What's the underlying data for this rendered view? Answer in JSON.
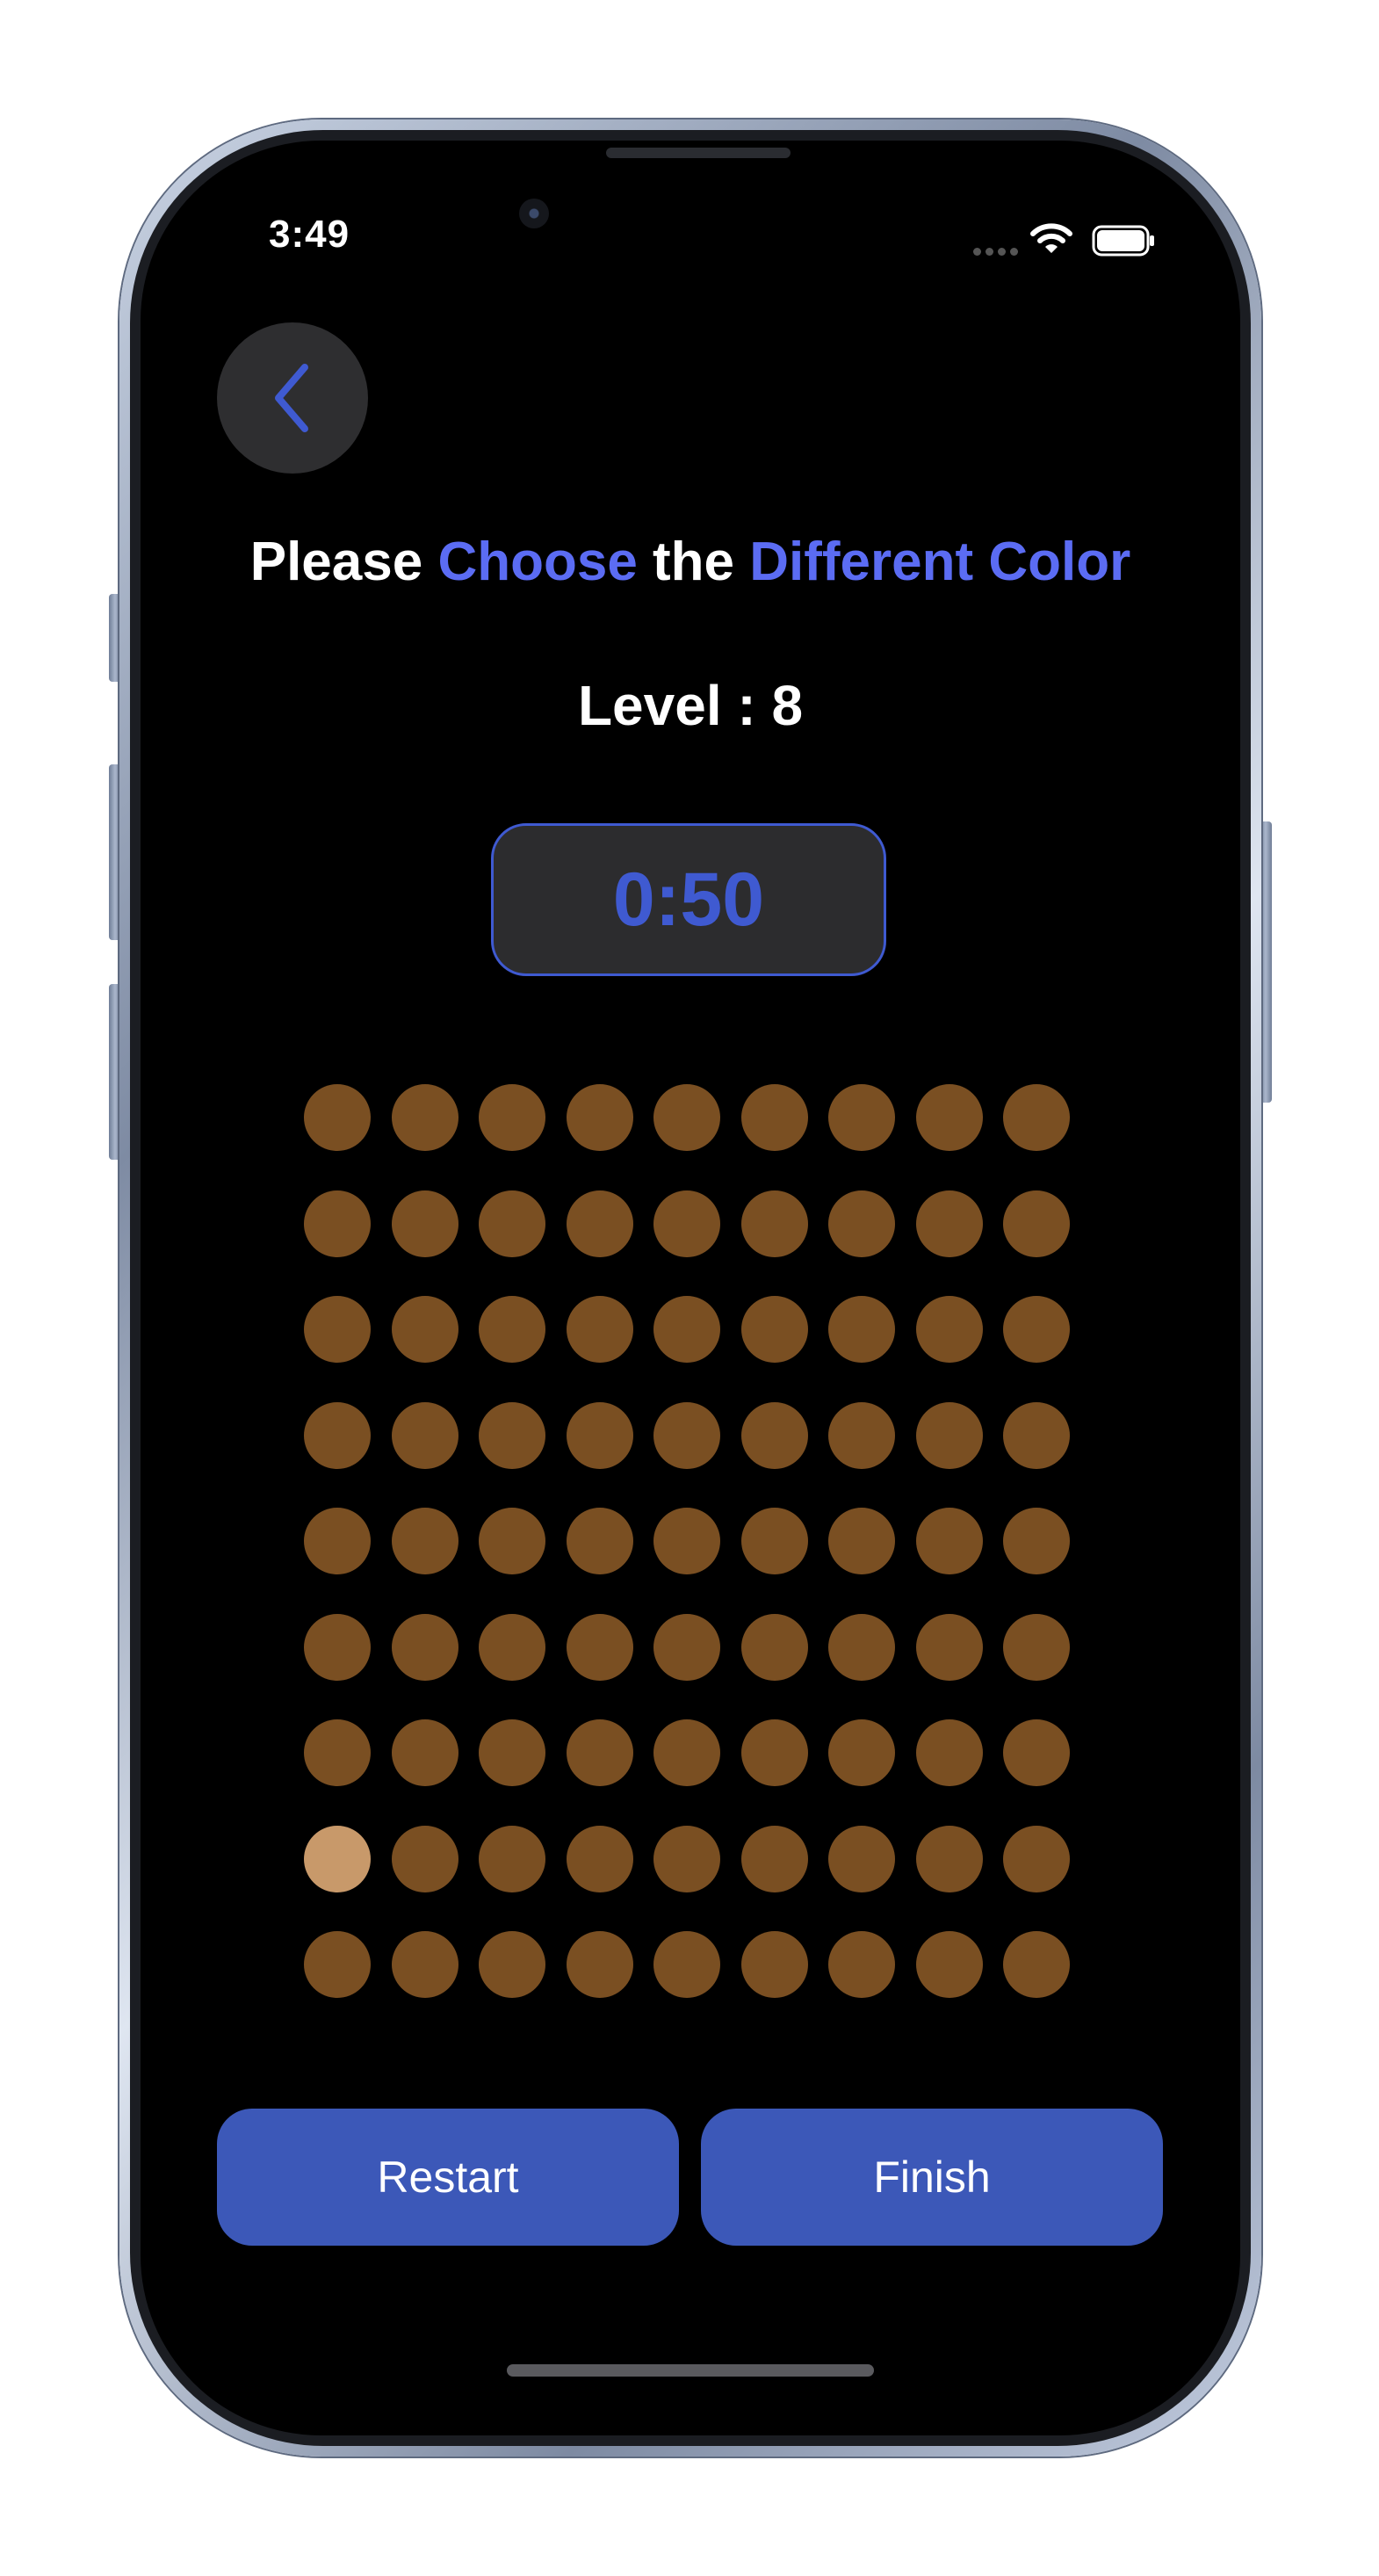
{
  "status_bar": {
    "time": "3:49"
  },
  "header": {
    "back_icon": "chevron-left-icon"
  },
  "title": {
    "part1": "Please ",
    "part2": "Choose",
    "part3": " the ",
    "part4": "Different Color"
  },
  "level": {
    "text": "Level : 8"
  },
  "timer": {
    "value": "0:50"
  },
  "grid": {
    "rows": 9,
    "cols": 9,
    "base_color": "#7a4f22",
    "odd_color": "#c8996a",
    "odd_row": 8,
    "odd_col": 1
  },
  "buttons": {
    "restart_label": "Restart",
    "finish_label": "Finish"
  },
  "colors": {
    "accent": "#5b6cf3",
    "timer_accent": "#3f5ad1",
    "button": "#3c58b8",
    "background": "#000000"
  }
}
